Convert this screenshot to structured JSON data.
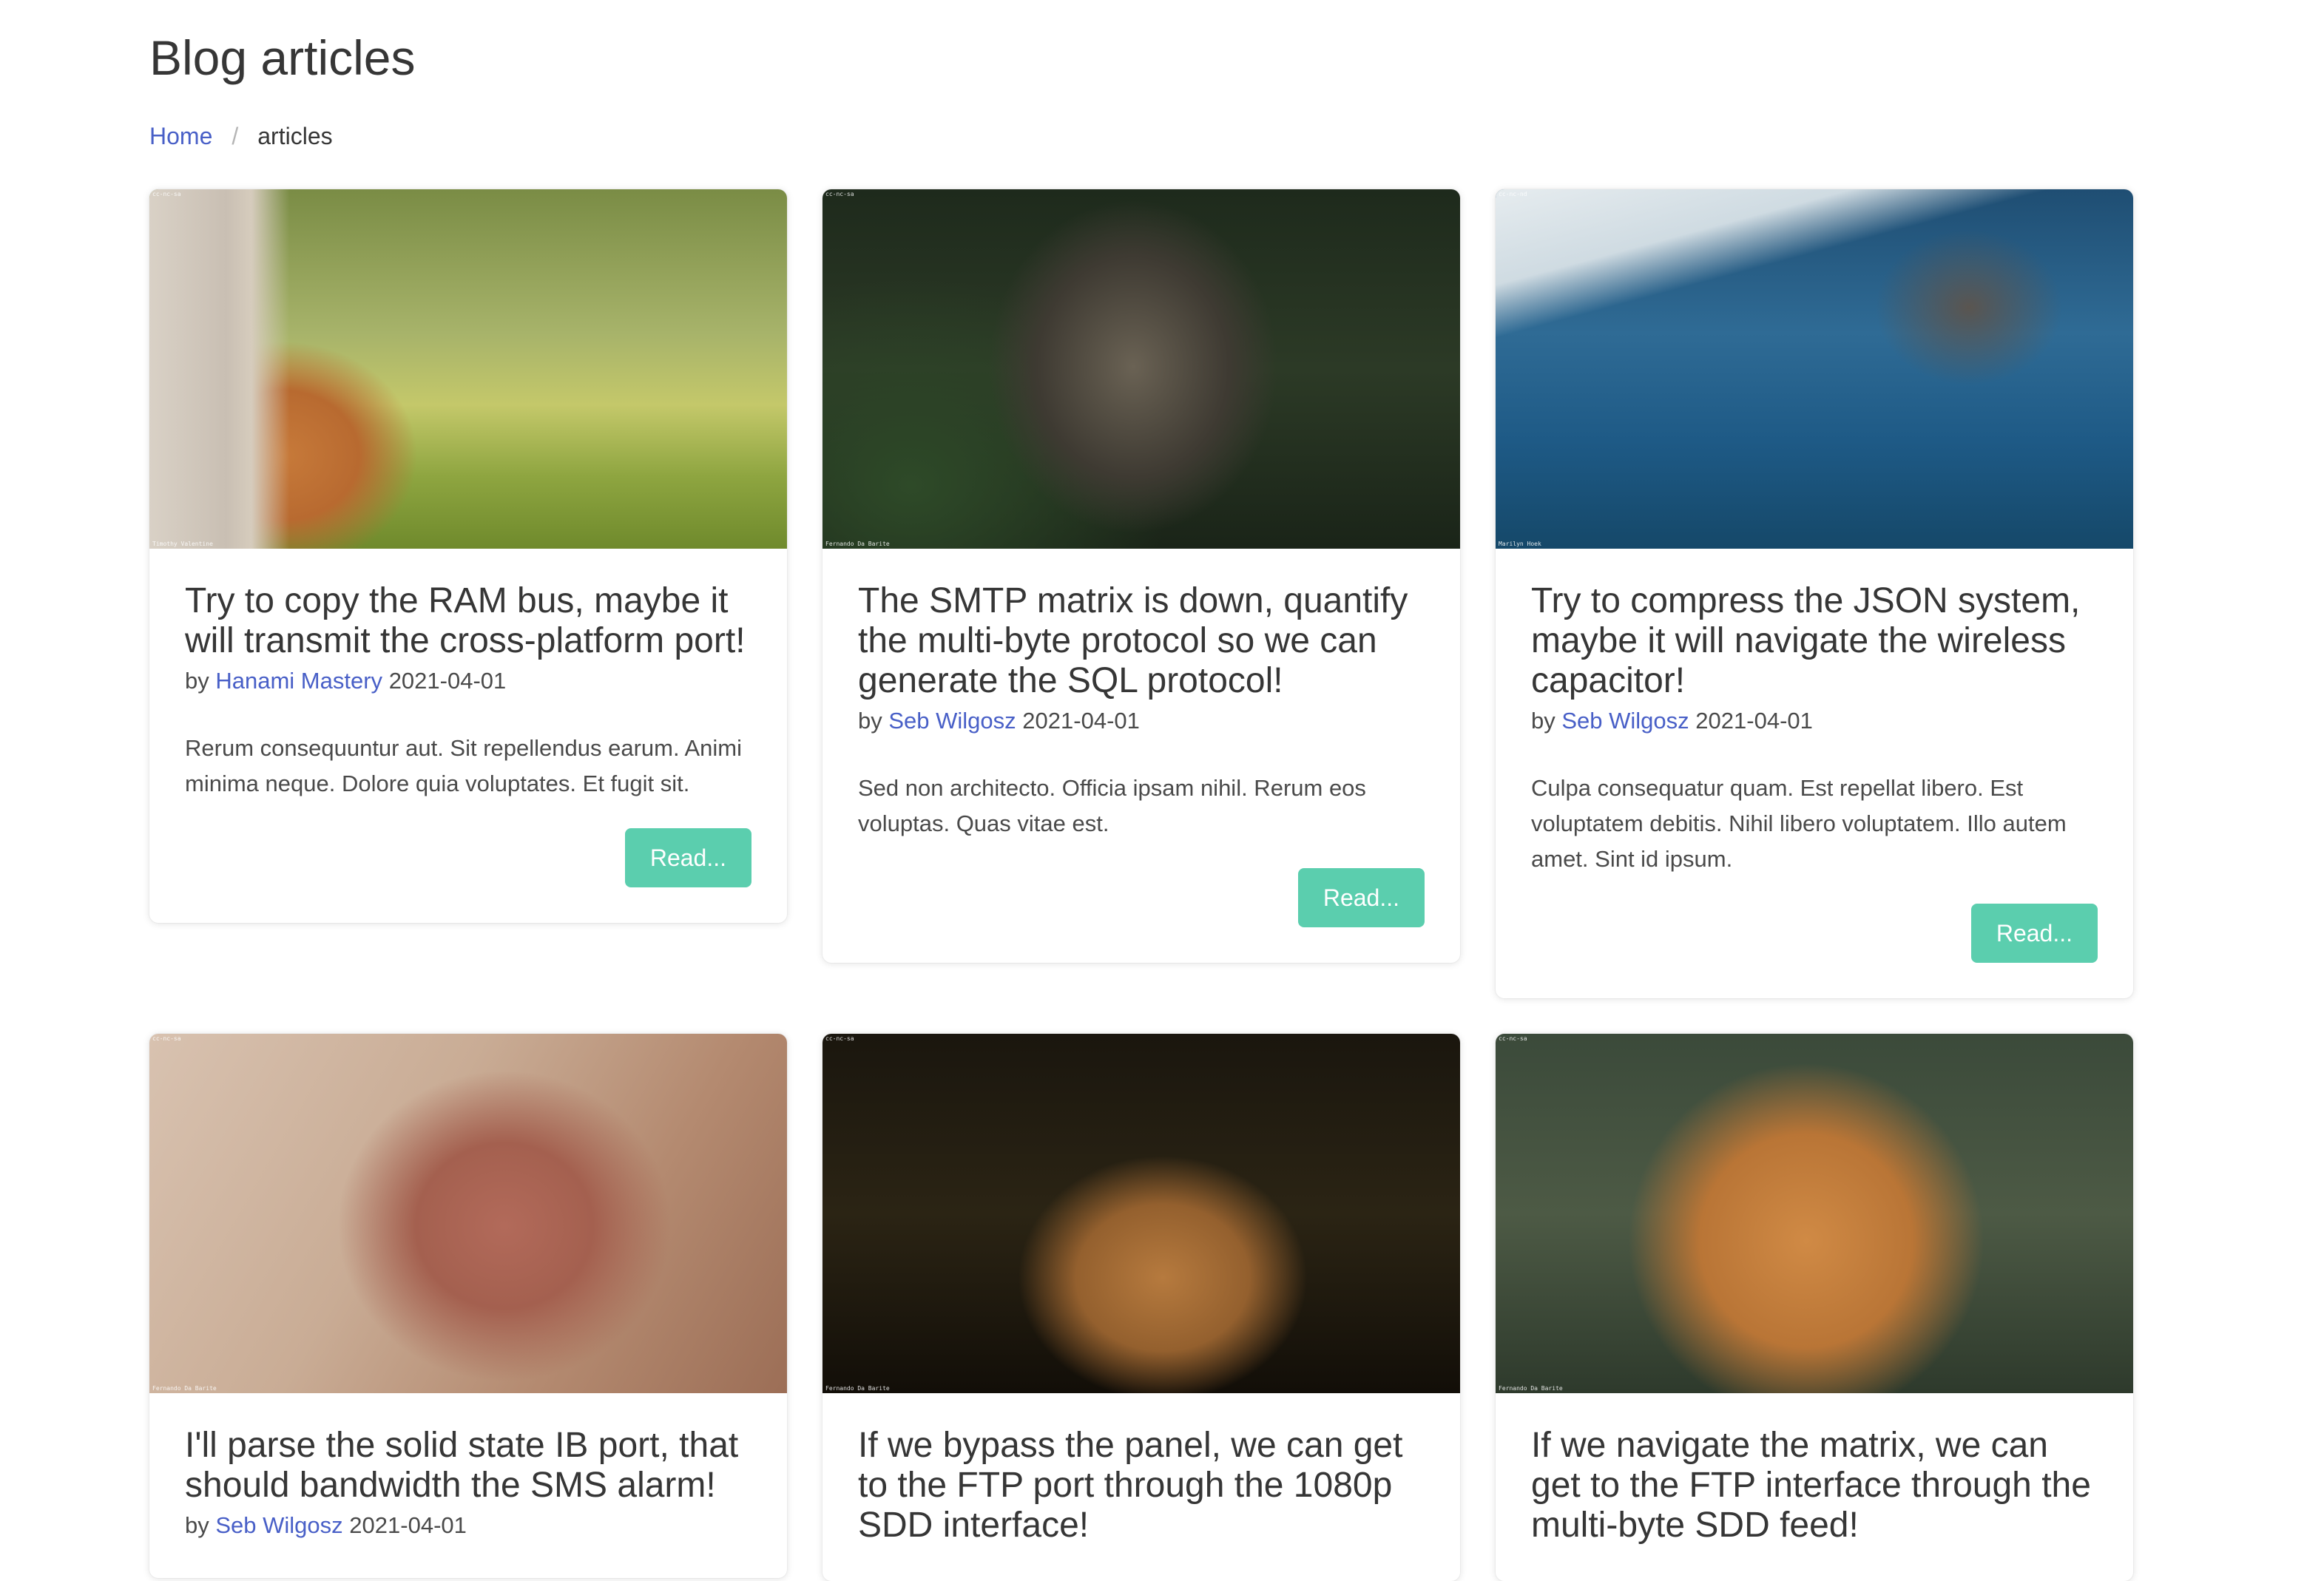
{
  "page_title": "Blog articles",
  "breadcrumb": {
    "home": "Home",
    "separator": "/",
    "current": "articles"
  },
  "read_label": "Read...",
  "by_label": "by",
  "articles": [
    {
      "title": "Try to copy the RAM bus, maybe it will transmit the cross-platform port!",
      "author": "Hanami Mastery",
      "date": "2021-04-01",
      "excerpt": "Rerum consequuntur aut. Sit repellendus earum. Animi minima neque. Dolore quia voluptates. Et fugit sit.",
      "image": "cat-looking-out-window",
      "credit_top": "cc-nc-sa",
      "credit_bottom": "Timothy Valentine"
    },
    {
      "title": "The SMTP matrix is down, quantify the multi-byte protocol so we can generate the SQL protocol!",
      "author": "Seb Wilgosz",
      "date": "2021-04-01",
      "excerpt": "Sed non architecto. Officia ipsam nihil. Rerum eos voluptas. Quas vitae est.",
      "image": "tabby-cat-in-plants",
      "credit_top": "cc-nc-sa",
      "credit_bottom": "Fernando Da Barite"
    },
    {
      "title": "Try to compress the JSON system, maybe it will navigate the wireless capacitor!",
      "author": "Seb Wilgosz",
      "date": "2021-04-01",
      "excerpt": "Culpa consequatur quam. Est repellat libero. Est voluptatem debitis. Nihil libero voluptatem. Illo autem amet. Sint id ipsum.",
      "image": "cat-drinking-from-pool",
      "credit_top": "cc-nc-nd",
      "credit_bottom": "Marilyn Hoek"
    },
    {
      "title": "I'll parse the solid state IB port, that should bandwidth the SMS alarm!",
      "author": "Seb Wilgosz",
      "date": "2021-04-01",
      "image": "cat-nose-closeup",
      "credit_top": "cc-nc-sa",
      "credit_bottom": "Fernando Da Barite"
    },
    {
      "title": "If we bypass the panel, we can get to the FTP port through the 1080p SDD interface!",
      "image": "orange-cat-at-night",
      "credit_top": "cc-nc-sa",
      "credit_bottom": "Fernando Da Barite"
    },
    {
      "title": "If we navigate the matrix, we can get to the FTP interface through the multi-byte SDD feed!",
      "image": "orange-tabby-cat-portrait",
      "credit_top": "cc-nc-sa",
      "credit_bottom": "Fernando Da Barite"
    }
  ]
}
